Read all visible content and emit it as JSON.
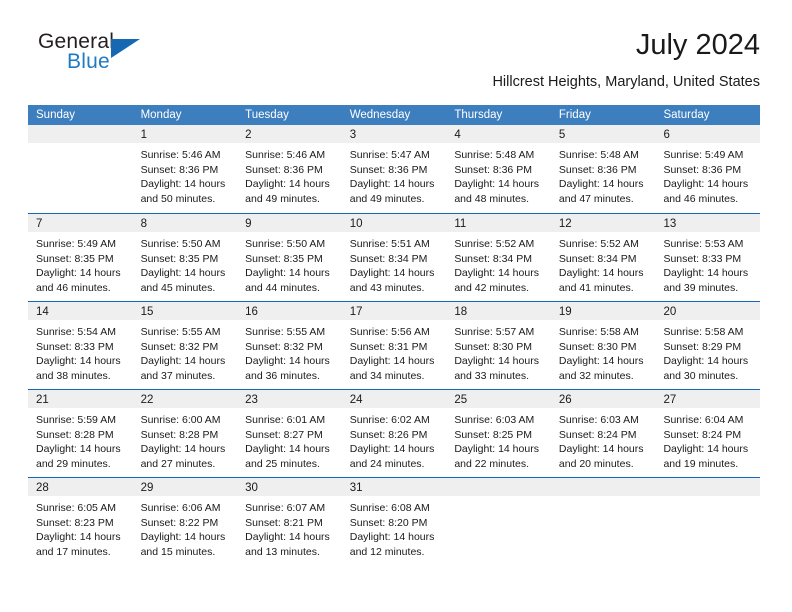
{
  "brand": {
    "name_top": "General",
    "name_bottom": "Blue",
    "triangle_icon": "brand-triangle-icon",
    "color_dark": "#231f20",
    "color_blue": "#1f7ac4"
  },
  "header": {
    "title": "July 2024",
    "subtitle": "Hillcrest Heights, Maryland, United States"
  },
  "theme": {
    "header_blue": "#3d7ebf",
    "row_rule_blue": "#1668b3",
    "day_band_gray": "#efefef"
  },
  "weekdays": [
    "Sunday",
    "Monday",
    "Tuesday",
    "Wednesday",
    "Thursday",
    "Friday",
    "Saturday"
  ],
  "weeks": [
    [
      {
        "day": "",
        "lines": []
      },
      {
        "day": "1",
        "lines": [
          "Sunrise: 5:46 AM",
          "Sunset: 8:36 PM",
          "Daylight: 14 hours",
          "and 50 minutes."
        ]
      },
      {
        "day": "2",
        "lines": [
          "Sunrise: 5:46 AM",
          "Sunset: 8:36 PM",
          "Daylight: 14 hours",
          "and 49 minutes."
        ]
      },
      {
        "day": "3",
        "lines": [
          "Sunrise: 5:47 AM",
          "Sunset: 8:36 PM",
          "Daylight: 14 hours",
          "and 49 minutes."
        ]
      },
      {
        "day": "4",
        "lines": [
          "Sunrise: 5:48 AM",
          "Sunset: 8:36 PM",
          "Daylight: 14 hours",
          "and 48 minutes."
        ]
      },
      {
        "day": "5",
        "lines": [
          "Sunrise: 5:48 AM",
          "Sunset: 8:36 PM",
          "Daylight: 14 hours",
          "and 47 minutes."
        ]
      },
      {
        "day": "6",
        "lines": [
          "Sunrise: 5:49 AM",
          "Sunset: 8:36 PM",
          "Daylight: 14 hours",
          "and 46 minutes."
        ]
      }
    ],
    [
      {
        "day": "7",
        "lines": [
          "Sunrise: 5:49 AM",
          "Sunset: 8:35 PM",
          "Daylight: 14 hours",
          "and 46 minutes."
        ]
      },
      {
        "day": "8",
        "lines": [
          "Sunrise: 5:50 AM",
          "Sunset: 8:35 PM",
          "Daylight: 14 hours",
          "and 45 minutes."
        ]
      },
      {
        "day": "9",
        "lines": [
          "Sunrise: 5:50 AM",
          "Sunset: 8:35 PM",
          "Daylight: 14 hours",
          "and 44 minutes."
        ]
      },
      {
        "day": "10",
        "lines": [
          "Sunrise: 5:51 AM",
          "Sunset: 8:34 PM",
          "Daylight: 14 hours",
          "and 43 minutes."
        ]
      },
      {
        "day": "11",
        "lines": [
          "Sunrise: 5:52 AM",
          "Sunset: 8:34 PM",
          "Daylight: 14 hours",
          "and 42 minutes."
        ]
      },
      {
        "day": "12",
        "lines": [
          "Sunrise: 5:52 AM",
          "Sunset: 8:34 PM",
          "Daylight: 14 hours",
          "and 41 minutes."
        ]
      },
      {
        "day": "13",
        "lines": [
          "Sunrise: 5:53 AM",
          "Sunset: 8:33 PM",
          "Daylight: 14 hours",
          "and 39 minutes."
        ]
      }
    ],
    [
      {
        "day": "14",
        "lines": [
          "Sunrise: 5:54 AM",
          "Sunset: 8:33 PM",
          "Daylight: 14 hours",
          "and 38 minutes."
        ]
      },
      {
        "day": "15",
        "lines": [
          "Sunrise: 5:55 AM",
          "Sunset: 8:32 PM",
          "Daylight: 14 hours",
          "and 37 minutes."
        ]
      },
      {
        "day": "16",
        "lines": [
          "Sunrise: 5:55 AM",
          "Sunset: 8:32 PM",
          "Daylight: 14 hours",
          "and 36 minutes."
        ]
      },
      {
        "day": "17",
        "lines": [
          "Sunrise: 5:56 AM",
          "Sunset: 8:31 PM",
          "Daylight: 14 hours",
          "and 34 minutes."
        ]
      },
      {
        "day": "18",
        "lines": [
          "Sunrise: 5:57 AM",
          "Sunset: 8:30 PM",
          "Daylight: 14 hours",
          "and 33 minutes."
        ]
      },
      {
        "day": "19",
        "lines": [
          "Sunrise: 5:58 AM",
          "Sunset: 8:30 PM",
          "Daylight: 14 hours",
          "and 32 minutes."
        ]
      },
      {
        "day": "20",
        "lines": [
          "Sunrise: 5:58 AM",
          "Sunset: 8:29 PM",
          "Daylight: 14 hours",
          "and 30 minutes."
        ]
      }
    ],
    [
      {
        "day": "21",
        "lines": [
          "Sunrise: 5:59 AM",
          "Sunset: 8:28 PM",
          "Daylight: 14 hours",
          "and 29 minutes."
        ]
      },
      {
        "day": "22",
        "lines": [
          "Sunrise: 6:00 AM",
          "Sunset: 8:28 PM",
          "Daylight: 14 hours",
          "and 27 minutes."
        ]
      },
      {
        "day": "23",
        "lines": [
          "Sunrise: 6:01 AM",
          "Sunset: 8:27 PM",
          "Daylight: 14 hours",
          "and 25 minutes."
        ]
      },
      {
        "day": "24",
        "lines": [
          "Sunrise: 6:02 AM",
          "Sunset: 8:26 PM",
          "Daylight: 14 hours",
          "and 24 minutes."
        ]
      },
      {
        "day": "25",
        "lines": [
          "Sunrise: 6:03 AM",
          "Sunset: 8:25 PM",
          "Daylight: 14 hours",
          "and 22 minutes."
        ]
      },
      {
        "day": "26",
        "lines": [
          "Sunrise: 6:03 AM",
          "Sunset: 8:24 PM",
          "Daylight: 14 hours",
          "and 20 minutes."
        ]
      },
      {
        "day": "27",
        "lines": [
          "Sunrise: 6:04 AM",
          "Sunset: 8:24 PM",
          "Daylight: 14 hours",
          "and 19 minutes."
        ]
      }
    ],
    [
      {
        "day": "28",
        "lines": [
          "Sunrise: 6:05 AM",
          "Sunset: 8:23 PM",
          "Daylight: 14 hours",
          "and 17 minutes."
        ]
      },
      {
        "day": "29",
        "lines": [
          "Sunrise: 6:06 AM",
          "Sunset: 8:22 PM",
          "Daylight: 14 hours",
          "and 15 minutes."
        ]
      },
      {
        "day": "30",
        "lines": [
          "Sunrise: 6:07 AM",
          "Sunset: 8:21 PM",
          "Daylight: 14 hours",
          "and 13 minutes."
        ]
      },
      {
        "day": "31",
        "lines": [
          "Sunrise: 6:08 AM",
          "Sunset: 8:20 PM",
          "Daylight: 14 hours",
          "and 12 minutes."
        ]
      },
      {
        "day": "",
        "lines": []
      },
      {
        "day": "",
        "lines": []
      },
      {
        "day": "",
        "lines": []
      }
    ]
  ]
}
